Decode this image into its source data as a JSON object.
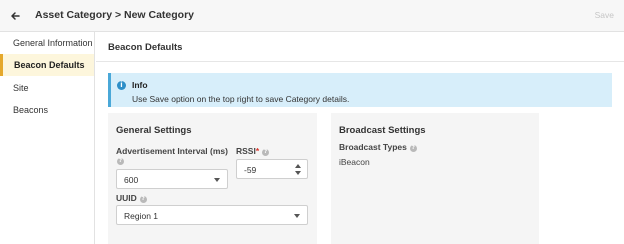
{
  "header": {
    "breadcrumb": "Asset Category > New Category",
    "save_label": "Save",
    "back_icon": "arrow-left-icon"
  },
  "sidebar": {
    "items": [
      {
        "label": "General Information",
        "active": false
      },
      {
        "label": "Beacon Defaults",
        "active": true
      },
      {
        "label": "Site",
        "active": false
      },
      {
        "label": "Beacons",
        "active": false
      }
    ]
  },
  "main": {
    "title": "Beacon Defaults",
    "info": {
      "icon_glyph": "i",
      "title": "Info",
      "text": "Use Save option on the top right to save Category details."
    },
    "general_settings": {
      "title": "General Settings",
      "adv_interval_label": "Advertisement Interval (ms)",
      "adv_interval_value": "600",
      "rssi_label": "RSSI",
      "rssi_required_mark": "*",
      "rssi_value": "-59",
      "uuid_label": "UUID",
      "uuid_value": "Region 1"
    },
    "broadcast_settings": {
      "title": "Broadcast Settings",
      "broadcast_types_label": "Broadcast Types",
      "broadcast_types_value": "iBeacon"
    },
    "help_glyph": "?"
  },
  "colors": {
    "accent": "#e5a82b",
    "active_bg": "#fdf6dc",
    "info_bg": "#d7eefa",
    "info_border": "#4aa8d8",
    "info_icon": "#2e8fc8",
    "required": "#d9342b",
    "save_disabled": "#c6c6c6"
  }
}
